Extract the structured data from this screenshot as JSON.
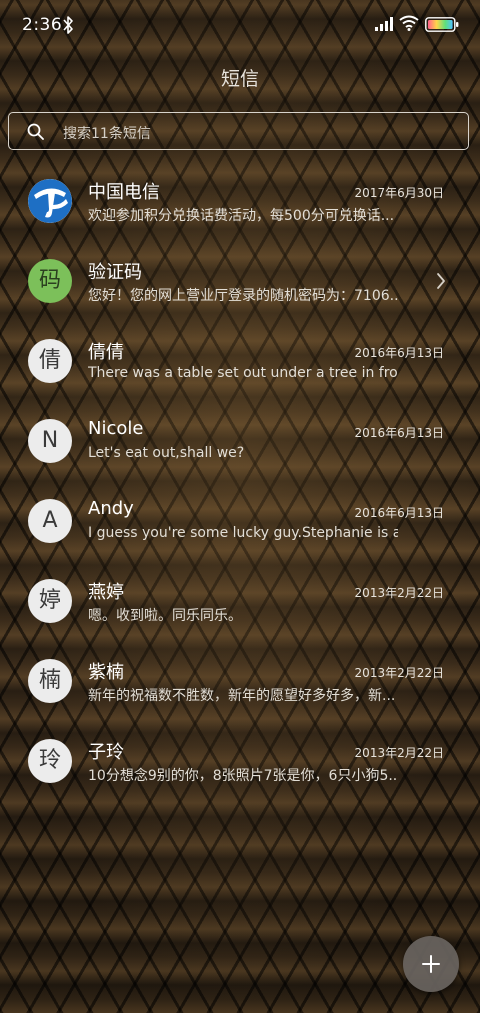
{
  "status_bar": {
    "time": "2:36"
  },
  "title": "短信",
  "search": {
    "placeholder": "搜索11条短信"
  },
  "conversations": [
    {
      "name": "中国电信",
      "date": "2017年6月30日",
      "preview": "欢迎参加积分兑换话费活动，每500分可兑换话...",
      "avatar": "",
      "avatar_type": "logo"
    },
    {
      "name": "验证码",
      "date": "",
      "preview": "您好！您的网上营业厅登录的随机密码为：7106...",
      "avatar": "码",
      "avatar_type": "green"
    },
    {
      "name": "倩倩",
      "date": "2016年6月13日",
      "preview": "There was a table set out under a tree in fron...",
      "avatar": "倩",
      "avatar_type": "default"
    },
    {
      "name": "Nicole",
      "date": "2016年6月13日",
      "preview": "Let's eat out,shall we?",
      "avatar": "N",
      "avatar_type": "default"
    },
    {
      "name": "Andy",
      "date": "2016年6月13日",
      "preview": "I guess you're some lucky guy.Stephanie is a...",
      "avatar": "A",
      "avatar_type": "default"
    },
    {
      "name": "燕婷",
      "date": "2013年2月22日",
      "preview": "嗯。收到啦。同乐同乐。",
      "avatar": "婷",
      "avatar_type": "default"
    },
    {
      "name": "紫楠",
      "date": "2013年2月22日",
      "preview": "新年的祝福数不胜数，新年的愿望好多好多，新...",
      "avatar": "楠",
      "avatar_type": "default"
    },
    {
      "name": "子玲",
      "date": "2013年2月22日",
      "preview": "10分想念9别的你，8张照片7张是你，6只小狗5...",
      "avatar": "玲",
      "avatar_type": "default"
    }
  ],
  "colors": {
    "verify_avatar": "#7cc05a",
    "telecom_logo": "#1e6fc4"
  },
  "icons": {
    "fab": "plus-icon",
    "search": "search-icon",
    "chevron": "chevron-right-icon"
  }
}
